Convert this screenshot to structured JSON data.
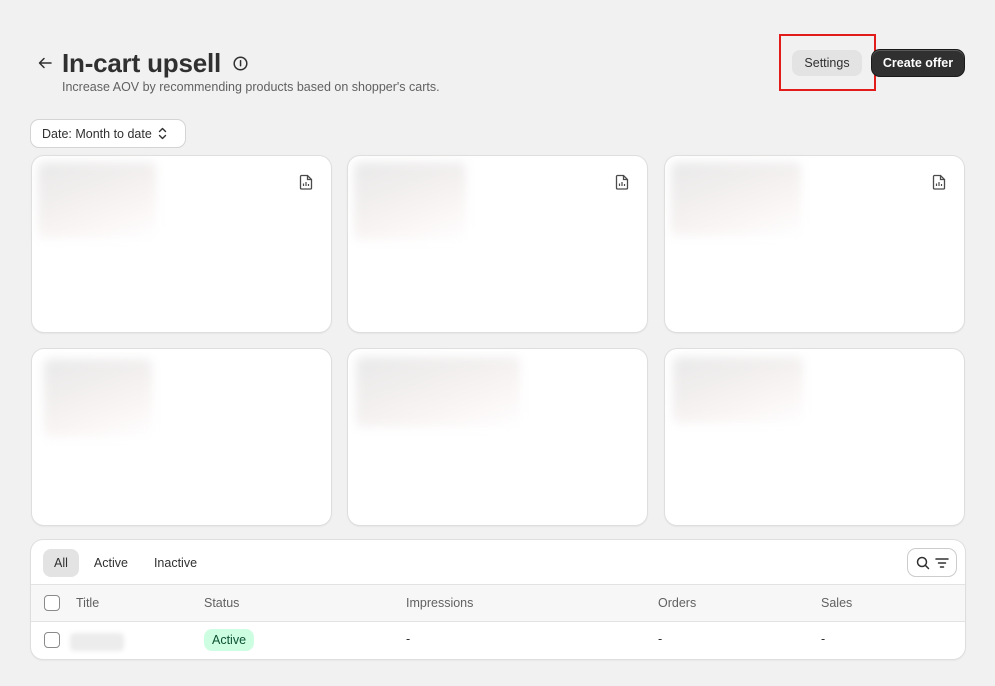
{
  "header": {
    "title": "In-cart upsell",
    "subtitle": "Increase AOV by recommending products based on shopper's carts.",
    "settings_label": "Settings",
    "create_label": "Create offer"
  },
  "filters": {
    "date_label": "Date: Month to date"
  },
  "cards": {
    "export_icon": "file-chart-icon"
  },
  "table": {
    "tabs": [
      "All",
      "Active",
      "Inactive"
    ],
    "selected_tab": "All",
    "columns": [
      "Title",
      "Status",
      "Impressions",
      "Orders",
      "Sales"
    ],
    "rows": [
      {
        "title": "",
        "status": "Active",
        "impressions": "-",
        "orders": "-",
        "sales": "-"
      }
    ]
  },
  "colors": {
    "primary_button": "#303030",
    "highlight": "#e21b1b",
    "status_active_bg": "#cdfee1",
    "status_active_text": "#0c5132"
  }
}
